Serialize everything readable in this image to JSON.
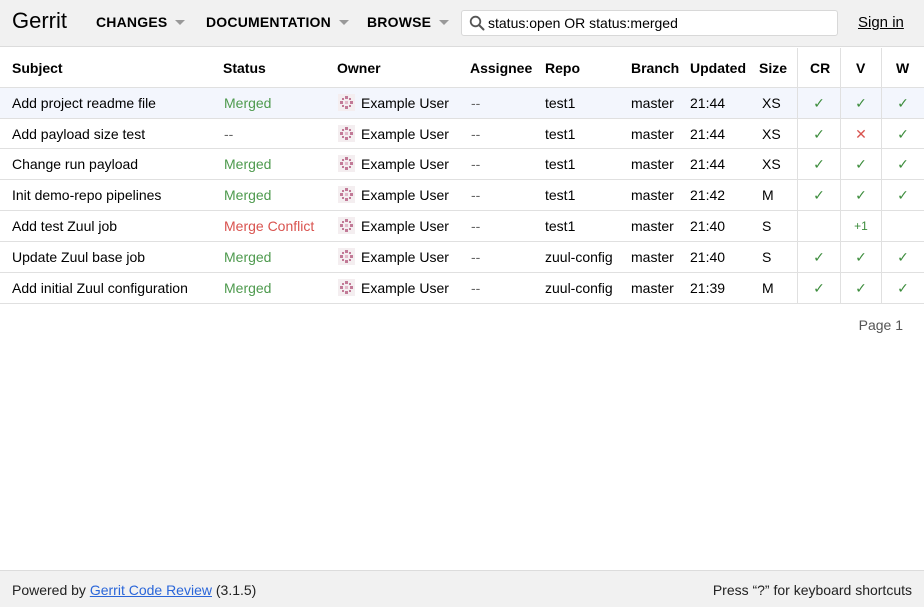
{
  "header": {
    "logo": "Gerrit",
    "nav": [
      {
        "label": "CHANGES"
      },
      {
        "label": "DOCUMENTATION"
      },
      {
        "label": "BROWSE"
      }
    ],
    "search": {
      "value": "status:open OR status:merged",
      "icon": "search-icon"
    },
    "signin": "Sign in"
  },
  "table": {
    "columns": [
      "Subject",
      "Status",
      "Owner",
      "Assignee",
      "Repo",
      "Branch",
      "Updated",
      "Size",
      "CR",
      "V",
      "W"
    ],
    "rows": [
      {
        "subject": "Add project readme file",
        "status": "Merged",
        "owner": "Example User",
        "assignee": "--",
        "repo": "test1",
        "branch": "master",
        "updated": "21:44",
        "size": "XS",
        "cr": "✓",
        "v": "✓",
        "w": "✓"
      },
      {
        "subject": "Add payload size test",
        "status": "--",
        "owner": "Example User",
        "assignee": "--",
        "repo": "test1",
        "branch": "master",
        "updated": "21:44",
        "size": "XS",
        "cr": "✓",
        "v": "✕",
        "w": "✓"
      },
      {
        "subject": "Change run payload",
        "status": "Merged",
        "owner": "Example User",
        "assignee": "--",
        "repo": "test1",
        "branch": "master",
        "updated": "21:44",
        "size": "XS",
        "cr": "✓",
        "v": "✓",
        "w": "✓"
      },
      {
        "subject": "Init demo-repo pipelines",
        "status": "Merged",
        "owner": "Example User",
        "assignee": "--",
        "repo": "test1",
        "branch": "master",
        "updated": "21:42",
        "size": "M",
        "cr": "✓",
        "v": "✓",
        "w": "✓"
      },
      {
        "subject": "Add test Zuul job",
        "status": "Merge Conflict",
        "owner": "Example User",
        "assignee": "--",
        "repo": "test1",
        "branch": "master",
        "updated": "21:40",
        "size": "S",
        "cr": "",
        "v": "+1",
        "w": ""
      },
      {
        "subject": "Update Zuul base job",
        "status": "Merged",
        "owner": "Example User",
        "assignee": "--",
        "repo": "zuul-config",
        "branch": "master",
        "updated": "21:40",
        "size": "S",
        "cr": "✓",
        "v": "✓",
        "w": "✓"
      },
      {
        "subject": "Add initial Zuul configuration",
        "status": "Merged",
        "owner": "Example User",
        "assignee": "--",
        "repo": "zuul-config",
        "branch": "master",
        "updated": "21:39",
        "size": "M",
        "cr": "✓",
        "v": "✓",
        "w": "✓"
      }
    ],
    "page_label": "Page 1"
  },
  "footer": {
    "powered_prefix": "Powered by",
    "powered_link": "Gerrit Code Review",
    "version": "(3.1.5)",
    "shortcuts": "Press “?” for keyboard shortcuts"
  },
  "colors": {
    "merged": "#4e9a4e",
    "conflict": "#d9534f",
    "approved": "#3c8c3c",
    "rejected": "#d9534f",
    "link": "#2a66d9"
  }
}
